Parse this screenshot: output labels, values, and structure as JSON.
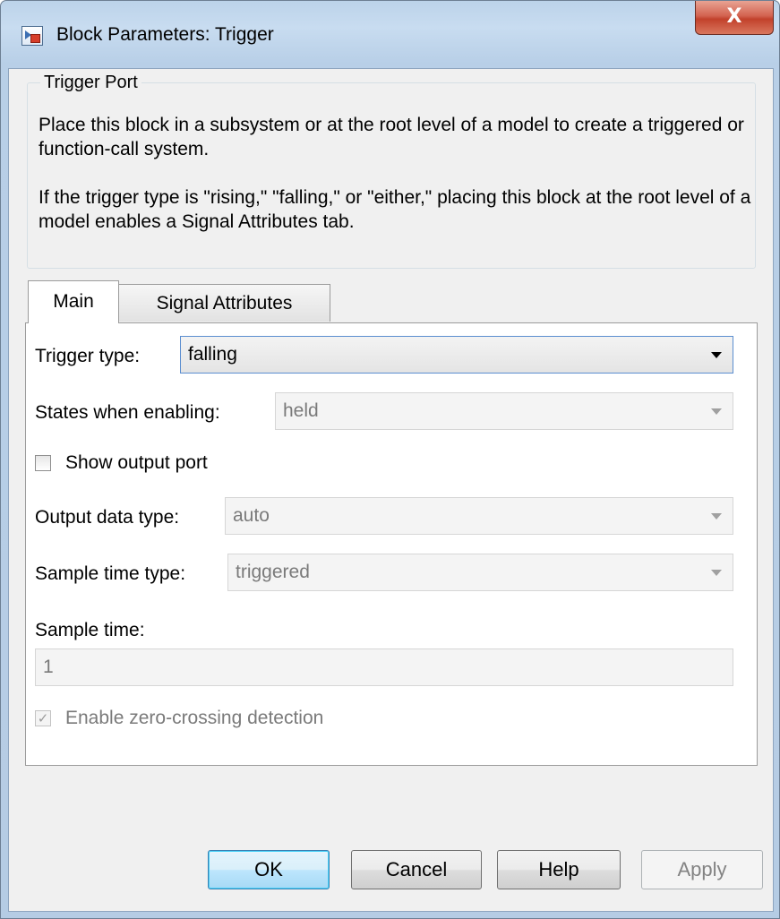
{
  "window": {
    "title": "Block Parameters: Trigger",
    "close_label": "X"
  },
  "group": {
    "title": "Trigger Port",
    "description_1": "Place this block in a subsystem or at the root level of a model to create a triggered or function-call system.",
    "description_2": "If the trigger type is \"rising,\" \"falling,\" or \"either,\" placing this block at the root level of a model enables a Signal Attributes tab."
  },
  "tabs": [
    {
      "label": "Main",
      "selected": true
    },
    {
      "label": "Signal Attributes",
      "selected": false
    }
  ],
  "main": {
    "trigger_type_label": "Trigger type:",
    "trigger_type_value": "falling",
    "states_label": "States when enabling:",
    "states_value": "held",
    "show_output_label": "Show output port",
    "show_output_checked": false,
    "output_type_label": "Output data type:",
    "output_type_value": "auto",
    "sample_time_type_label": "Sample time type:",
    "sample_time_type_value": "triggered",
    "sample_time_label": "Sample time:",
    "sample_time_value": "1",
    "zero_crossing_label": "Enable zero-crossing detection",
    "zero_crossing_checked": true,
    "check_glyph": "✓"
  },
  "buttons": {
    "ok": "OK",
    "cancel": "Cancel",
    "help": "Help",
    "apply": "Apply"
  },
  "colors": {
    "frame": "#b5cce4",
    "close_button": "#c2412b",
    "default_button_border": "#3c7fb1",
    "enabled_dropdown_border": "#5b8ed0",
    "disabled_text": "#7a7a7a"
  }
}
